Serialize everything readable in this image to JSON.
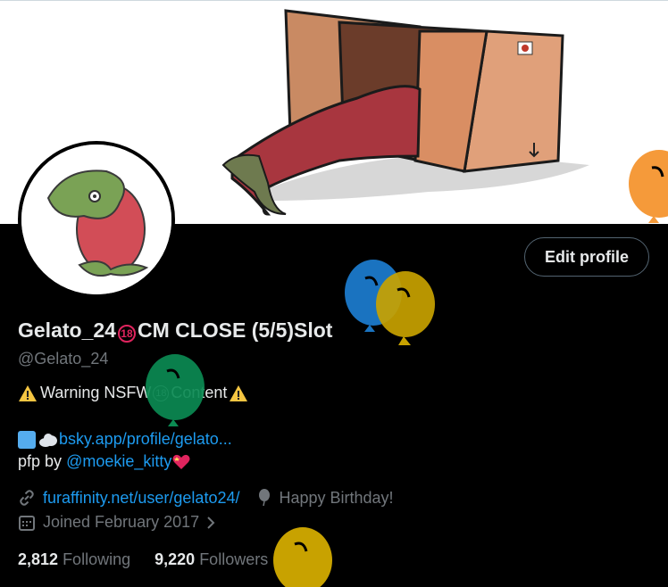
{
  "profile": {
    "display_name_part1": "Gelato_24",
    "display_name_badge": "18",
    "display_name_part2": "CM CLOSE (5/5)Slot",
    "handle": "@Gelato_24",
    "edit_button": "Edit profile"
  },
  "bio": {
    "warning_before": "Warning NSFW",
    "warning_badge": "18",
    "warning_after": "Content",
    "bsky_link": "bsky.app/profile/gelato...",
    "pfp_prefix": "pfp by",
    "pfp_credit": "@moekie_kitty"
  },
  "meta": {
    "website": "furaffinity.net/user/gelato24/",
    "birthday": "Happy Birthday!",
    "joined": "Joined February 2017"
  },
  "stats": {
    "following_count": "2,812",
    "following_label": "Following",
    "followers_count": "9,220",
    "followers_label": "Followers"
  },
  "icons": {
    "website": "link-icon",
    "birthday": "balloon-icon",
    "joined": "calendar-icon",
    "joined_chevron": "chevron-right-icon",
    "warning": "warning-icon",
    "bsky": "blue-square-icon",
    "cloud": "cloud-icon",
    "heart": "sparkling-heart-icon"
  },
  "colors": {
    "background": "#000000",
    "text": "#e7e9ea",
    "secondary": "#71767b",
    "link": "#1d9bf0",
    "balloon_orange": "#f59a3a",
    "balloon_blue": "#1a73c0",
    "balloon_gold": "#c8a200",
    "balloon_green": "#0b8a52"
  }
}
